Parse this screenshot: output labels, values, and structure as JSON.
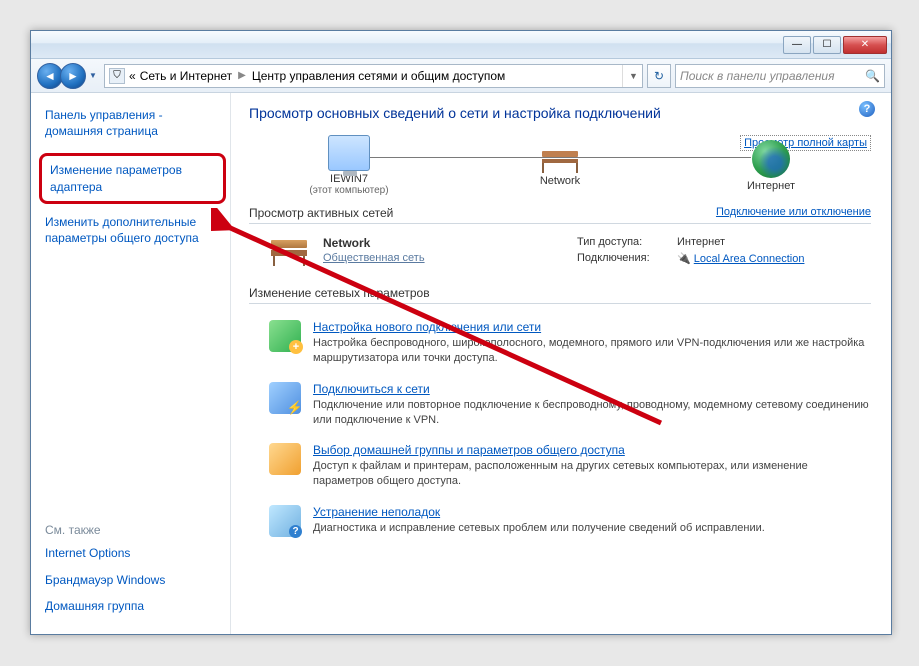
{
  "address": {
    "prefix": "«",
    "seg1": "Сеть и Интернет",
    "seg2": "Центр управления сетями и общим доступом"
  },
  "search": {
    "placeholder": "Поиск в панели управления"
  },
  "sidebar": {
    "home": "Панель управления - домашняя страница",
    "adapter": "Изменение параметров адаптера",
    "sharing": "Изменить дополнительные параметры общего доступа",
    "see_also": "См. также",
    "links": {
      "inet": "Internet Options",
      "fw": "Брандмауэр Windows",
      "hg": "Домашняя группа"
    }
  },
  "main": {
    "title": "Просмотр основных сведений о сети и настройка подключений",
    "fullmap": "Просмотр полной карты",
    "map": {
      "pc": "IEWIN7",
      "pc_sub": "(этот компьютер)",
      "net": "Network",
      "inet": "Интернет"
    },
    "active_hdr": "Просмотр активных сетей",
    "active_link": "Подключение или отключение",
    "active": {
      "name": "Network",
      "type": "Общественная сеть",
      "access_lbl": "Тип доступа:",
      "access_val": "Интернет",
      "conn_lbl": "Подключения:",
      "conn_val": "Local Area Connection"
    },
    "change_hdr": "Изменение сетевых параметров",
    "tasks": [
      {
        "title": "Настройка нового подключения или сети",
        "desc": "Настройка беспроводного, широкополосного, модемного, прямого или VPN-подключения или же настройка маршрутизатора или точки доступа."
      },
      {
        "title": "Подключиться к сети",
        "desc": "Подключение или повторное подключение к беспроводному, проводному, модемному сетевому соединению или подключение к VPN."
      },
      {
        "title": "Выбор домашней группы и параметров общего доступа",
        "desc": "Доступ к файлам и принтерам, расположенным на других сетевых компьютерах, или изменение параметров общего доступа."
      },
      {
        "title": "Устранение неполадок",
        "desc": "Диагностика и исправление сетевых проблем или получение сведений об исправлении."
      }
    ]
  }
}
